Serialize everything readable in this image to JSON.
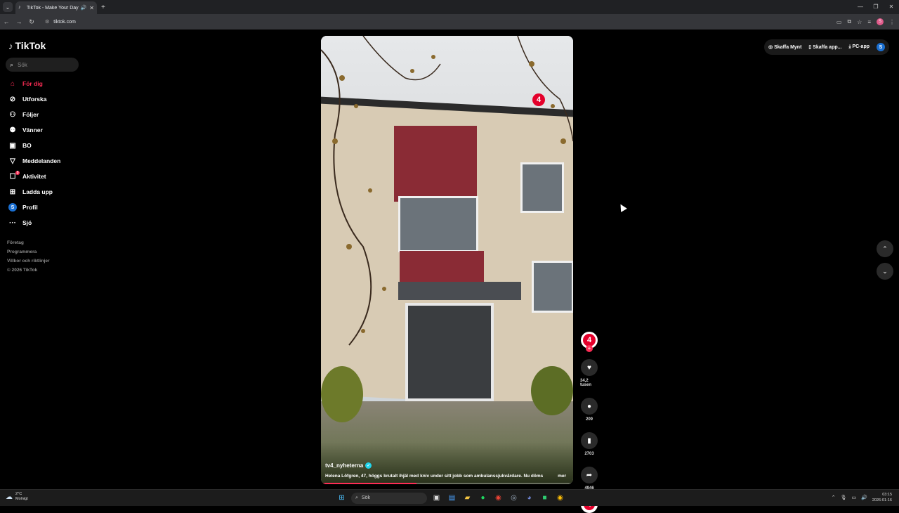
{
  "browser": {
    "tab_title": "TikTok - Make Your Day",
    "url": "tiktok.com"
  },
  "tiktok": {
    "logo_text": "TikTok",
    "search_placeholder": "Sök",
    "nav": [
      {
        "label": "För dig",
        "icon": "home-icon",
        "active": true
      },
      {
        "label": "Utforska",
        "icon": "compass-icon"
      },
      {
        "label": "Följer",
        "icon": "following-icon"
      },
      {
        "label": "Vänner",
        "icon": "friends-icon"
      },
      {
        "label": "BO",
        "icon": "live-icon"
      },
      {
        "label": "Meddelanden",
        "icon": "messages-icon"
      },
      {
        "label": "Aktivitet",
        "icon": "activity-icon",
        "badge": "3"
      },
      {
        "label": "Ladda upp",
        "icon": "upload-icon"
      },
      {
        "label": "Profil",
        "icon": "profile-avatar",
        "avatar_letter": "S"
      },
      {
        "label": "Sjö",
        "icon": "more-icon"
      }
    ],
    "footer": [
      "Företag",
      "Programmera",
      "Villkor och riktlinjer",
      "© 2026 TikTok"
    ],
    "top_actions": {
      "coins": "Skaffa Mynt",
      "app": "Skaffa app...",
      "pc": "PC-app",
      "user_letter": "S"
    },
    "video": {
      "author": "tv4_nyheterna",
      "caption": "Helena Löfgren, 47, höggs brutalt ihjäl med kniv under sitt jobb som ambulanssjukvårdare. Nu döms",
      "more": "mer",
      "progress": 0.38,
      "channel_logo": "4"
    },
    "actions": {
      "likes": "34,2 tusen",
      "comments": "209",
      "saves": "2703",
      "shares": "4946"
    }
  },
  "taskbar": {
    "temp": "2°C",
    "weather_desc": "Molnigt",
    "search": "Sök",
    "time": "03:15",
    "date": "2026-01-16"
  }
}
